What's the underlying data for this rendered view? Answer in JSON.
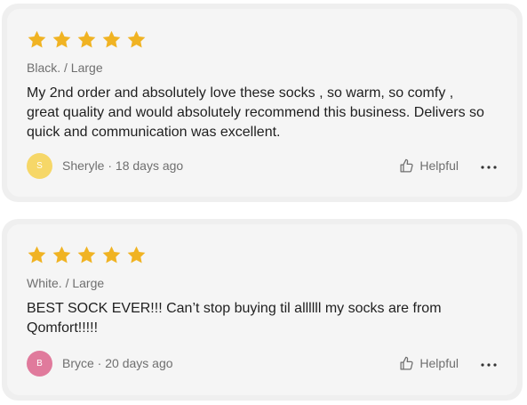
{
  "star_color": "#f0b323",
  "reviews": [
    {
      "rating": 5,
      "variant": "Black. / Large",
      "text": "My 2nd order and absolutely love these socks , so warm, so comfy , great quality and would absolutely recommend this business. Delivers so quick and communication was excellent.",
      "avatar_initial": "S",
      "avatar_color": "#f6d768",
      "author": "Sheryle",
      "separator": " · ",
      "time": "18 days ago",
      "helpful_label": "Helpful",
      "helpful_icon": "thumbs-up-icon",
      "more_icon": "more-options-icon"
    },
    {
      "rating": 5,
      "variant": "White. / Large",
      "text": "BEST SOCK EVER!!! Can’t stop buying til allllll my socks are from Qomfort!!!!!",
      "avatar_initial": "B",
      "avatar_color": "#e07a9c",
      "author": "Bryce",
      "separator": " · ",
      "time": "20 days ago",
      "helpful_label": "Helpful",
      "helpful_icon": "thumbs-up-icon",
      "more_icon": "more-options-icon"
    }
  ]
}
